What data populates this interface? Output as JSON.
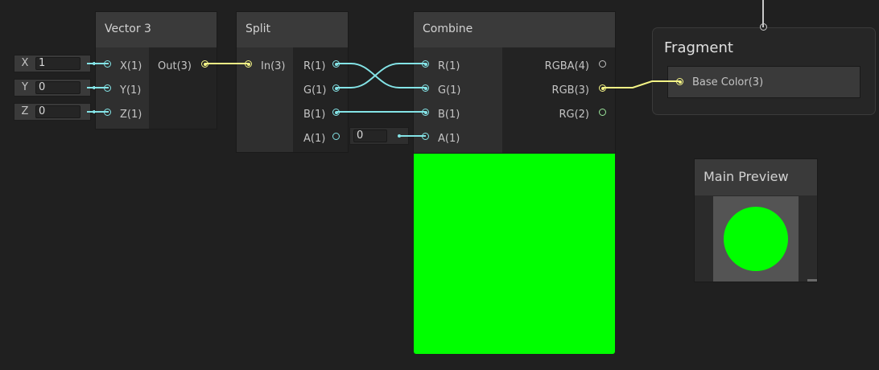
{
  "colors": {
    "canvas": "#202020",
    "node_body": "#2b2b2b",
    "node_header": "#3a3a3a",
    "float_port": "#84e4e7",
    "vector3_port": "#f4f486",
    "vector2_port": "#9be69b",
    "vector4_port": "#c0c0c0",
    "preview_fill": "#00ff00"
  },
  "vector3": {
    "title": "Vector 3",
    "inputs": [
      "X(1)",
      "Y(1)",
      "Z(1)"
    ],
    "output": "Out(3)",
    "fields": [
      {
        "label": "X",
        "value": "1"
      },
      {
        "label": "Y",
        "value": "0"
      },
      {
        "label": "Z",
        "value": "0"
      }
    ]
  },
  "split": {
    "title": "Split",
    "input": "In(3)",
    "outputs": [
      "R(1)",
      "G(1)",
      "B(1)",
      "A(1)"
    ]
  },
  "combine": {
    "title": "Combine",
    "inputs": [
      "R(1)",
      "G(1)",
      "B(1)",
      "A(1)"
    ],
    "outputs": [
      "RGBA(4)",
      "RGB(3)",
      "RG(2)"
    ],
    "a_field_value": "0"
  },
  "fragment": {
    "title": "Fragment",
    "slot": "Base Color(3)"
  },
  "main_preview": {
    "title": "Main Preview"
  }
}
